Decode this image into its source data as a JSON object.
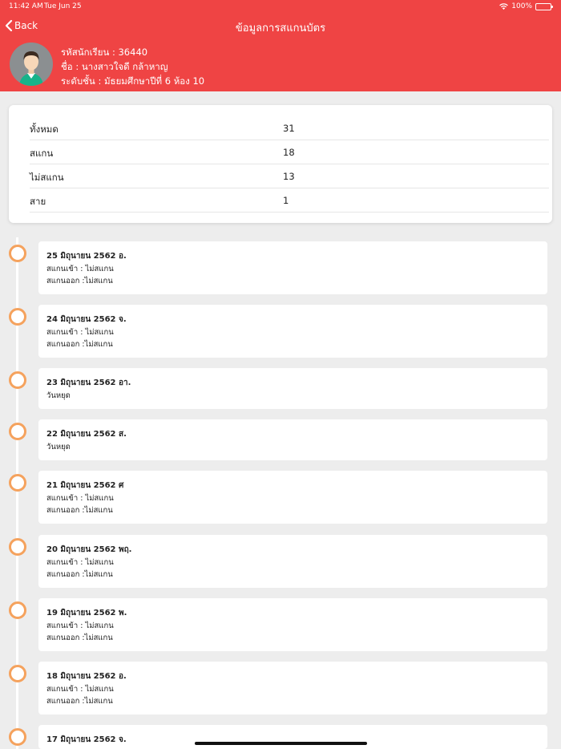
{
  "status_bar": {
    "time": "11:42 AM",
    "date": "Tue Jun 25",
    "battery": "100%"
  },
  "nav": {
    "back_label": "Back",
    "title": "ข้อมูลการสแกนบัตร"
  },
  "student": {
    "id_line": "รหัสนักเรียน : 36440",
    "name_line": "ชื่อ : นางสาวใจดี กล้าหาญ",
    "level_line": "ระดับชั้น : มัธยมศึกษาปีที่ 6 ห้อง 10"
  },
  "summary": [
    {
      "label": "ทั้งหมด",
      "value": "31"
    },
    {
      "label": "สแกน",
      "value": "18"
    },
    {
      "label": "ไม่สแกน",
      "value": "13"
    },
    {
      "label": "สาย",
      "value": "1"
    }
  ],
  "timeline": [
    {
      "date": "25 มิถุนายน 2562 อ.",
      "line1": "สแกนเข้า : ไม่สแกน",
      "line2": "สแกนออก :ไม่สแกน"
    },
    {
      "date": "24 มิถุนายน 2562 จ.",
      "line1": "สแกนเข้า : ไม่สแกน",
      "line2": "สแกนออก :ไม่สแกน"
    },
    {
      "date": "23 มิถุนายน 2562 อา.",
      "line1": "วันหยุด"
    },
    {
      "date": "22 มิถุนายน 2562 ส.",
      "line1": "วันหยุด"
    },
    {
      "date": "21 มิถุนายน 2562 ศ",
      "line1": "สแกนเข้า : ไม่สแกน",
      "line2": "สแกนออก :ไม่สแกน"
    },
    {
      "date": "20 มิถุนายน 2562 พฤ.",
      "line1": "สแกนเข้า : ไม่สแกน",
      "line2": "สแกนออก :ไม่สแกน"
    },
    {
      "date": "19 มิถุนายน 2562 พ.",
      "line1": "สแกนเข้า : ไม่สแกน",
      "line2": "สแกนออก :ไม่สแกน"
    },
    {
      "date": "18 มิถุนายน 2562 อ.",
      "line1": "สแกนเข้า : ไม่สแกน",
      "line2": "สแกนออก :ไม่สแกน"
    },
    {
      "date": "17 มิถุนายน 2562 จ."
    }
  ],
  "colors": {
    "header": "#ef4444",
    "timeline_dot": "#f5a25d",
    "background": "#ededed"
  }
}
